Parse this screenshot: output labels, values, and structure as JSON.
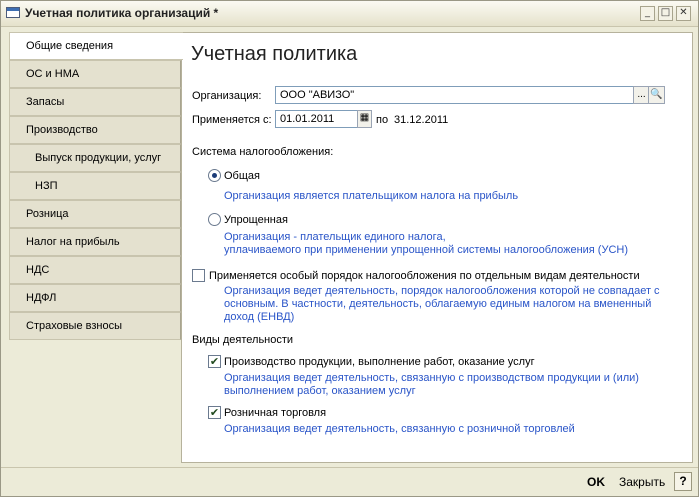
{
  "window": {
    "title": "Учетная политика организаций *",
    "minimize": "_",
    "maximize": "□",
    "close": "✕"
  },
  "nav": {
    "items": [
      {
        "label": "Общие сведения"
      },
      {
        "label": "ОС и НМА"
      },
      {
        "label": "Запасы"
      },
      {
        "label": "Производство"
      },
      {
        "label": "Выпуск продукции, услуг"
      },
      {
        "label": "НЗП"
      },
      {
        "label": "Розница"
      },
      {
        "label": "Налог на прибыль"
      },
      {
        "label": "НДС"
      },
      {
        "label": "НДФЛ"
      },
      {
        "label": "Страховые взносы"
      }
    ]
  },
  "main": {
    "title": "Учетная политика",
    "org_label": "Организация:",
    "org_value": "ООО \"АВИЗО\"",
    "select_btn": "...",
    "open_btn": "🔍",
    "applies_label": "Применяется с:",
    "applies_from": "01.01.2011",
    "applies_to_label": "по",
    "applies_to": "31.12.2011",
    "tax_system_label": "Система налогообложения:",
    "general_label": "Общая",
    "general_desc": "Организация является плательщиком налога на прибыль",
    "simplified_label": "Упрощенная",
    "simplified_desc_1": "Организация - плательщик единого налога,",
    "simplified_desc_2": "уплачиваемого при применении упрощенной системы налогообложения (УСН)",
    "special_label": "Применяется особый порядок налогообложения по отдельным видам деятельности",
    "special_desc_1": "Организация ведет деятельность, порядок налогообложения которой не совпадает с",
    "special_desc_2": "основным. В частности, деятельность, облагаемую единым налогом на вмененный",
    "special_desc_3": "доход (ЕНВД)",
    "activities_label": "Виды деятельности",
    "production_label": "Производство  продукции, выполнение работ, оказание услуг",
    "production_desc_1": "Организация ведет деятельность, связанную с производством продукции и (или)",
    "production_desc_2": "выполнением работ, оказанием услуг",
    "retail_label": "Розничная торговля",
    "retail_desc": "Организация ведет деятельность, связанную с розничной торговлей"
  },
  "footer": {
    "ok_label": "OK",
    "close_label": "Закрыть",
    "help_label": "?"
  }
}
